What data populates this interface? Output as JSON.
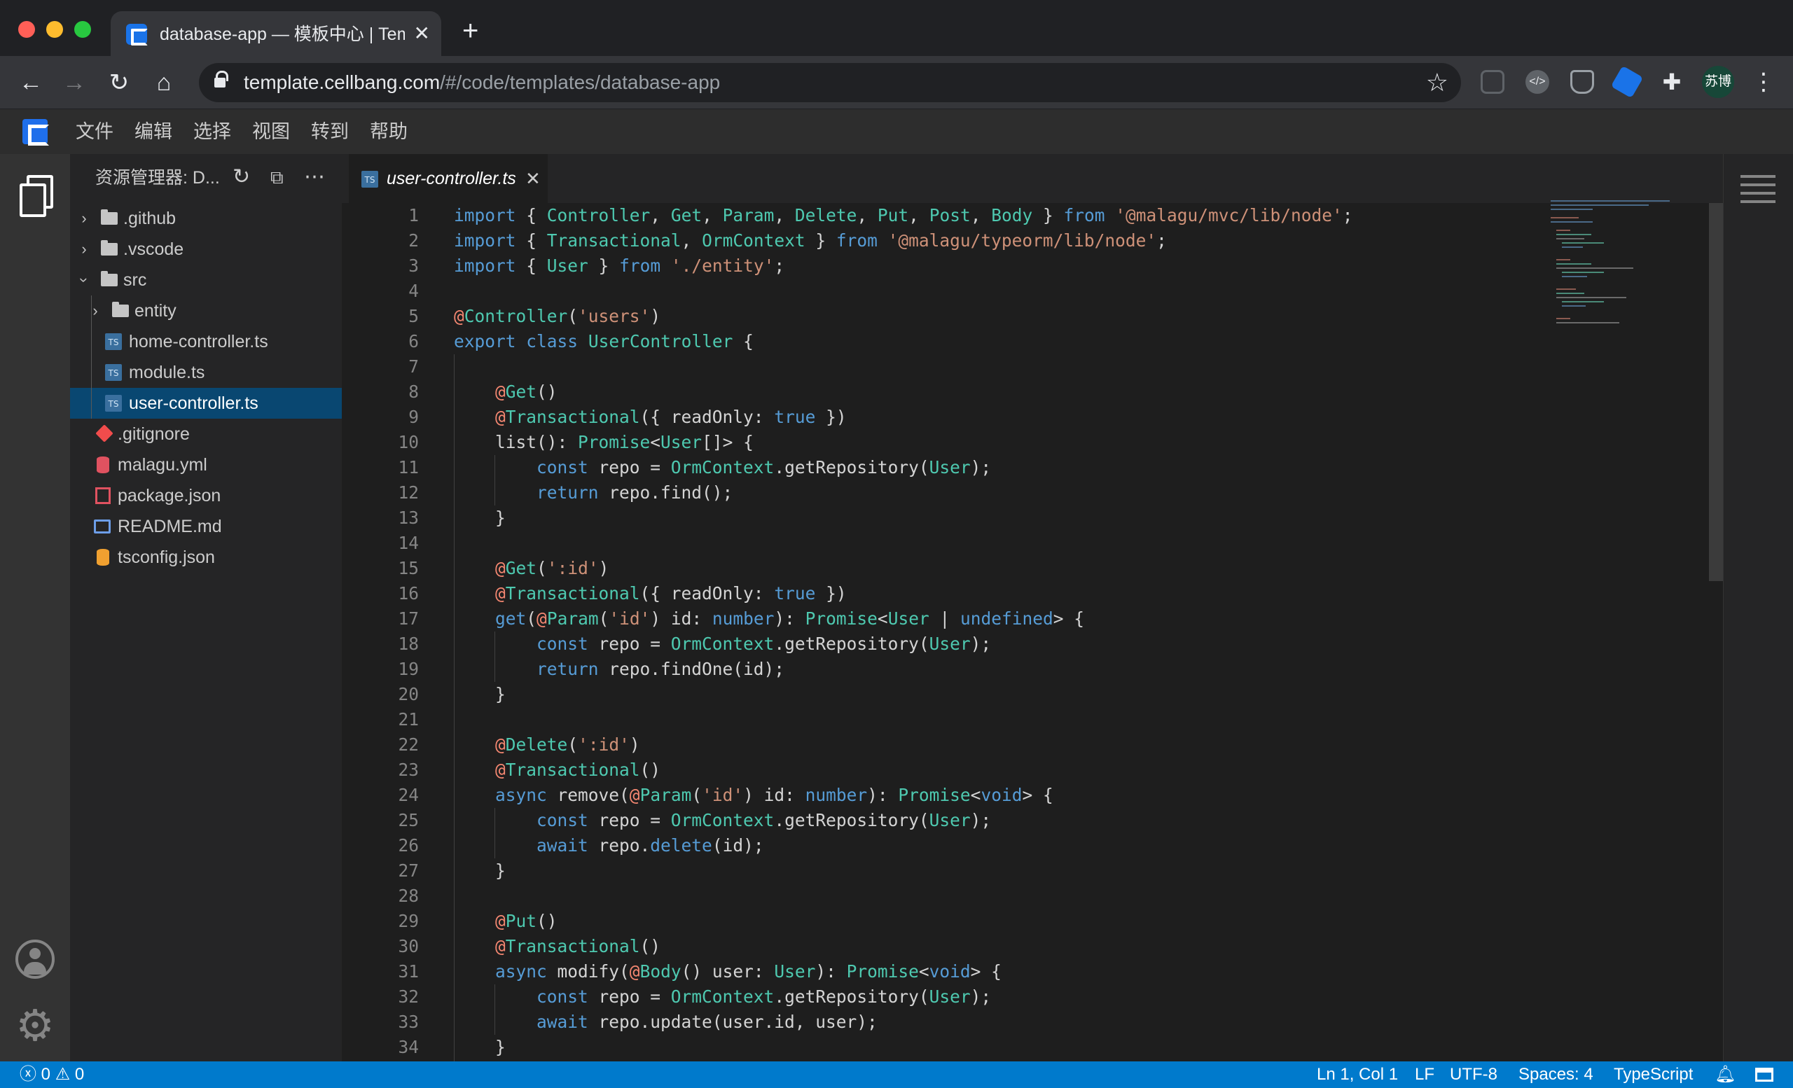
{
  "browser": {
    "tab_title": "database-app — 模板中心 | Template",
    "url_host": "template.cellbang.com",
    "url_path": "/#/code/templates/database-app",
    "profile_label": "苏博"
  },
  "ide": {
    "menu": [
      "文件",
      "编辑",
      "选择",
      "视图",
      "转到",
      "帮助"
    ],
    "explorer_title": "资源管理器: D...",
    "tree": [
      {
        "label": ".github",
        "type": "folder",
        "expanded": false
      },
      {
        "label": ".vscode",
        "type": "folder",
        "expanded": false
      },
      {
        "label": "src",
        "type": "folder",
        "expanded": true
      },
      {
        "label": "entity",
        "type": "folder",
        "expanded": false
      },
      {
        "label": "home-controller.ts",
        "type": "ts"
      },
      {
        "label": "module.ts",
        "type": "ts"
      },
      {
        "label": "user-controller.ts",
        "type": "ts",
        "selected": true
      },
      {
        "label": ".gitignore",
        "type": "git"
      },
      {
        "label": "malagu.yml",
        "type": "yml"
      },
      {
        "label": "package.json",
        "type": "json"
      },
      {
        "label": "README.md",
        "type": "md"
      },
      {
        "label": "tsconfig.json",
        "type": "json"
      }
    ],
    "editor_tab": "user-controller.ts",
    "ts_badge": "TS",
    "line_numbers": [
      "1",
      "2",
      "3",
      "4",
      "5",
      "6",
      "7",
      "8",
      "9",
      "10",
      "11",
      "12",
      "13",
      "14",
      "15",
      "16",
      "17",
      "18",
      "19",
      "20",
      "21",
      "22",
      "23",
      "24",
      "25",
      "26",
      "27",
      "28",
      "29",
      "30",
      "31",
      "32",
      "33",
      "34"
    ]
  },
  "status": {
    "errors": "0",
    "warnings": "0",
    "cursor": "Ln 1, Col 1",
    "eol": "LF",
    "encoding": "UTF-8",
    "indent": "Spaces: 4",
    "language": "TypeScript"
  },
  "colors": {
    "accent": "#007acc",
    "selection": "#094771",
    "keyword": "#569cd6",
    "type": "#4ec9b0",
    "string": "#ce9178",
    "decorator": "#f48771"
  }
}
